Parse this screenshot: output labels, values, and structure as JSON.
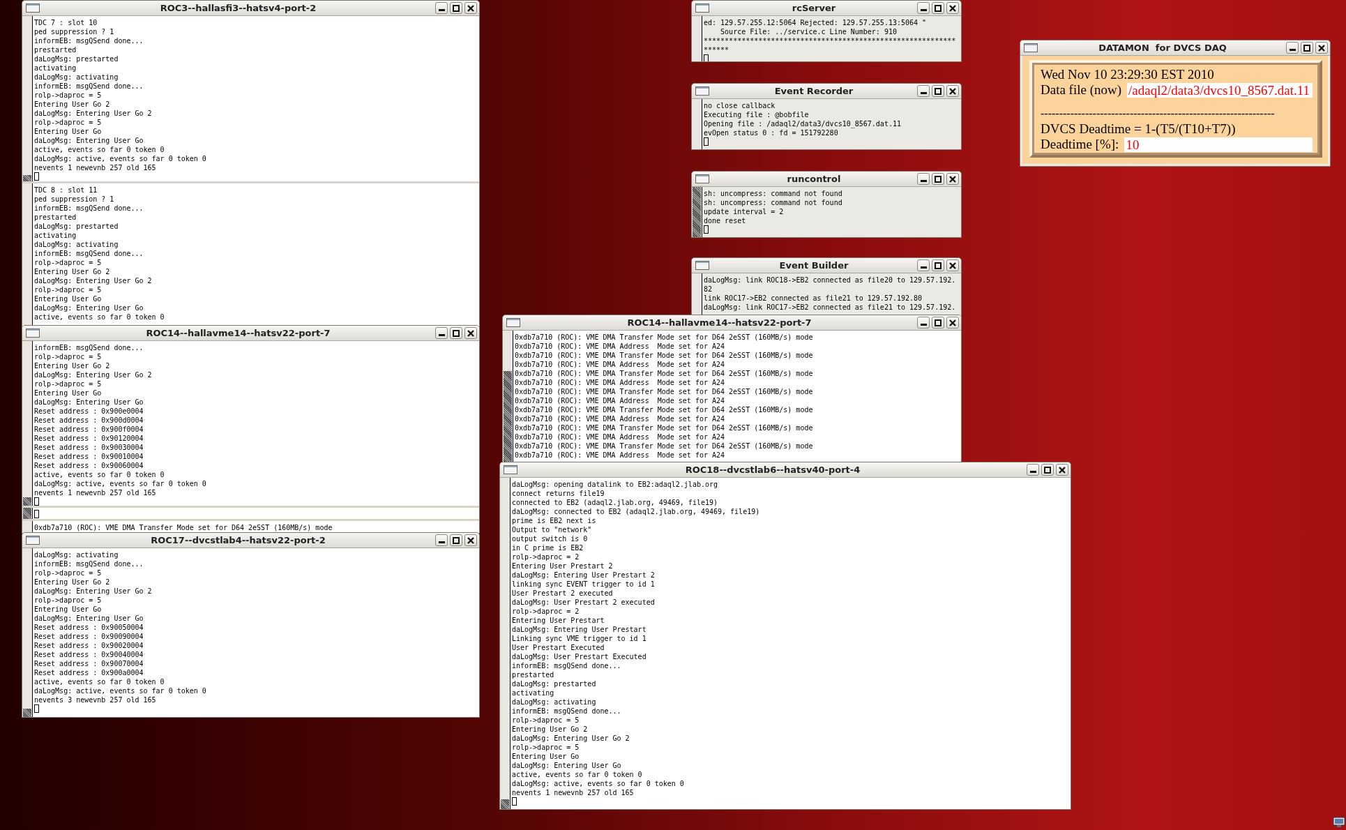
{
  "windows": [
    {
      "title": "ROC3--hallasfi3--hatsv4-port-2",
      "panes": [
        {
          "lines": [
            "TDC 7 : slot 10",
            "ped suppression ? 1",
            "informEB: msgQSend done...",
            "prestarted",
            "daLogMsg: prestarted",
            "activating",
            "daLogMsg: activating",
            "informEB: msgQSend done...",
            "rolp->daproc = 5",
            "Entering User Go 2",
            "daLogMsg: Entering User Go 2",
            "rolp->daproc = 5",
            "Entering User Go",
            "daLogMsg: Entering User Go",
            "active, events so far 0 token 0",
            "daLogMsg: active, events so far 0 token 0",
            "nevents 1 newevnb 257 old 165"
          ],
          "cursor": true
        },
        {
          "lines": [
            "TDC 8 : slot 11",
            "ped suppression ? 1",
            "informEB: msgQSend done...",
            "prestarted",
            "daLogMsg: prestarted",
            "activating",
            "daLogMsg: activating",
            "informEB: msgQSend done...",
            "rolp->daproc = 5",
            "Entering User Go 2",
            "daLogMsg: Entering User Go 2",
            "rolp->daproc = 5",
            "Entering User Go",
            "daLogMsg: Entering User Go",
            "active, events so far 0 token 0"
          ]
        }
      ]
    },
    {
      "title": "ROC14--hallavme14--hatsv22-port-7",
      "panes": [
        {
          "lines": [
            "informEB: msgQSend done...",
            "rolp->daproc = 5",
            "Entering User Go 2",
            "daLogMsg: Entering User Go 2",
            "rolp->daproc = 5",
            "Entering User Go",
            "daLogMsg: Entering User Go",
            "Reset address : 0x900e0004",
            "Reset address : 0x900d0004",
            "Reset address : 0x900f0004",
            "Reset address : 0x90120004",
            "Reset address : 0x90030004",
            "Reset address : 0x90010004",
            "Reset address : 0x90060004",
            "active, events so far 0 token 0",
            "daLogMsg: active, events so far 0 token 0",
            "nevents 1 newevnb 257 old 165"
          ],
          "cursor": true
        },
        {
          "cursor": true
        },
        {
          "lines": [
            "0xdb7a710 (ROC): VME DMA Transfer Mode set for D64 2eSST (160MB/s) mode"
          ]
        }
      ]
    },
    {
      "title": "ROC17--dvcstlab4--hatsv22-port-2",
      "panes": [
        {
          "lines": [
            "daLogMsg: activating",
            "informEB: msgQSend done...",
            "rolp->daproc = 5",
            "Entering User Go 2",
            "daLogMsg: Entering User Go 2",
            "rolp->daproc = 5",
            "Entering User Go",
            "daLogMsg: Entering User Go",
            "Reset address : 0x90050004",
            "Reset address : 0x90090004",
            "Reset address : 0x90020004",
            "Reset address : 0x90040004",
            "Reset address : 0x90070004",
            "Reset address : 0x900a0004",
            "active, events so far 0 token 0",
            "daLogMsg: active, events so far 0 token 0",
            "nevents 3 newevnb 257 old 165"
          ],
          "cursor": true
        }
      ]
    },
    {
      "title": "rcServer",
      "panes": [
        {
          "lines": [
            "ed: 129.57.255.12:5064 Rejected: 129.57.255.13:5064 \"",
            "    Source File: ../service.c Line Number: 910",
            "************************************************************",
            "******"
          ],
          "cursor": true
        }
      ]
    },
    {
      "title": "Event Recorder",
      "panes": [
        {
          "lines": [
            "no close callback",
            "Executing file : @bobfile",
            "Opening file : /adaql2/data3/dvcs10_8567.dat.11",
            "evOpen status 0 : fd = 151792280"
          ],
          "cursor": true
        }
      ]
    },
    {
      "title": "runcontrol",
      "panes": [
        {
          "lines": [
            "sh: uncompress: command not found",
            "sh: uncompress: command not found",
            "update interval = 2",
            "done reset"
          ],
          "cursor": true
        }
      ]
    },
    {
      "title": "Event Builder",
      "panes": [
        {
          "lines": [
            "daLogMsg: link ROC18->EB2 connected as file20 to 129.57.192.",
            "82",
            "link ROC17->EB2 connected as file21 to 129.57.192.80",
            "daLogMsg: link ROC17->EB2 connected as file21 to 129.57.192."
          ]
        }
      ]
    },
    {
      "title": "ROC14--hallavme14--hatsv22-port-7",
      "panes": [
        {
          "lines": [
            "0xdb7a710 (ROC): VME DMA Transfer Mode set for D64 2eSST (160MB/s) mode",
            "0xdb7a710 (ROC): VME DMA Address  Mode set for A24",
            "0xdb7a710 (ROC): VME DMA Transfer Mode set for D64 2eSST (160MB/s) mode",
            "0xdb7a710 (ROC): VME DMA Address  Mode set for A24",
            "0xdb7a710 (ROC): VME DMA Transfer Mode set for D64 2eSST (160MB/s) mode",
            "0xdb7a710 (ROC): VME DMA Address  Mode set for A24",
            "0xdb7a710 (ROC): VME DMA Transfer Mode set for D64 2eSST (160MB/s) mode",
            "0xdb7a710 (ROC): VME DMA Address  Mode set for A24",
            "0xdb7a710 (ROC): VME DMA Transfer Mode set for D64 2eSST (160MB/s) mode",
            "0xdb7a710 (ROC): VME DMA Address  Mode set for A24",
            "0xdb7a710 (ROC): VME DMA Transfer Mode set for D64 2eSST (160MB/s) mode",
            "0xdb7a710 (ROC): VME DMA Address  Mode set for A24",
            "0xdb7a710 (ROC): VME DMA Transfer Mode set for D64 2eSST (160MB/s) mode",
            "0xdb7a710 (ROC): VME DMA Address  Mode set for A24"
          ]
        }
      ]
    },
    {
      "title": "ROC18--dvcstlab6--hatsv40-port-4",
      "panes": [
        {
          "lines": [
            "daLogMsg: opening datalink to EB2:adaql2.jlab.org",
            "connect returns file19",
            "connected to EB2 (adaql2.jlab.org, 49469, file19)",
            "daLogMsg: connected to EB2 (adaql2.jlab.org, 49469, file19)",
            "prime is EB2 next is",
            "Output to \"network\"",
            "output switch is 0",
            "in C prime is EB2",
            "rolp->daproc = 2",
            "Entering User Prestart 2",
            "daLogMsg: Entering User Prestart 2",
            "linking sync EVENT trigger to id 1",
            "User Prestart 2 executed",
            "daLogMsg: User Prestart 2 executed",
            "rolp->daproc = 2",
            "Entering User Prestart",
            "daLogMsg: Entering User Prestart",
            "Linking sync VME trigger to id 1",
            "User Prestart Executed",
            "daLogMsg: User Prestart Executed",
            "informEB: msgQSend done...",
            "prestarted",
            "daLogMsg: prestarted",
            "activating",
            "daLogMsg: activating",
            "informEB: msgQSend done...",
            "rolp->daproc = 5",
            "Entering User Go 2",
            "daLogMsg: Entering User Go 2",
            "rolp->daproc = 5",
            "Entering User Go",
            "daLogMsg: Entering User Go",
            "active, events so far 0 token 0",
            "daLogMsg: active, events so far 0 token 0",
            "nevents 1 newevnb 257 old 165"
          ],
          "cursor": true
        }
      ]
    }
  ],
  "datamon": {
    "title": "DATAMON  for DVCS DAQ",
    "rows": [
      {
        "kind": "text",
        "text": "Wed Nov 10 23:29:30 EST 2010"
      },
      {
        "kind": "field",
        "label": "Data file (now)",
        "value": "/adaql2/data3/dvcs10_8567.dat.11"
      },
      {
        "kind": "spacer"
      },
      {
        "kind": "rule",
        "text": "---------------------------------------------------------------"
      },
      {
        "kind": "text",
        "text": "DVCS Deadtime = 1-(T5/(T10+T7))"
      },
      {
        "kind": "field",
        "label": "Deadtime [%]:",
        "value": "10"
      }
    ]
  }
}
